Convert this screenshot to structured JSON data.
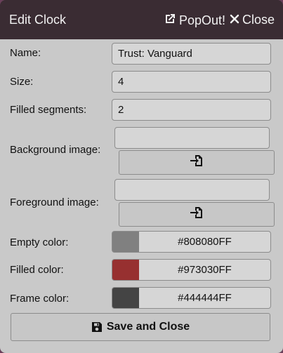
{
  "window": {
    "title": "Edit Clock",
    "popout_label": "PopOut!",
    "close_label": "Close"
  },
  "fields": {
    "name": {
      "label": "Name:",
      "value": "Trust: Vanguard"
    },
    "size": {
      "label": "Size:",
      "value": "4"
    },
    "filled_segments": {
      "label": "Filled segments:",
      "value": "2"
    },
    "background_image": {
      "label": "Background image:",
      "value": ""
    },
    "foreground_image": {
      "label": "Foreground image:",
      "value": ""
    },
    "empty_color": {
      "label": "Empty color:",
      "value": "#808080FF",
      "swatch": "#808080"
    },
    "filled_color": {
      "label": "Filled color:",
      "value": "#973030FF",
      "swatch": "#973030"
    },
    "frame_color": {
      "label": "Frame color:",
      "value": "#444444FF",
      "swatch": "#444444"
    }
  },
  "actions": {
    "save_label": "Save and Close",
    "file_picker_icon": "file-import-icon",
    "save_icon": "floppy-disk-icon",
    "popout_icon": "external-link-icon",
    "close_icon": "close-icon"
  }
}
